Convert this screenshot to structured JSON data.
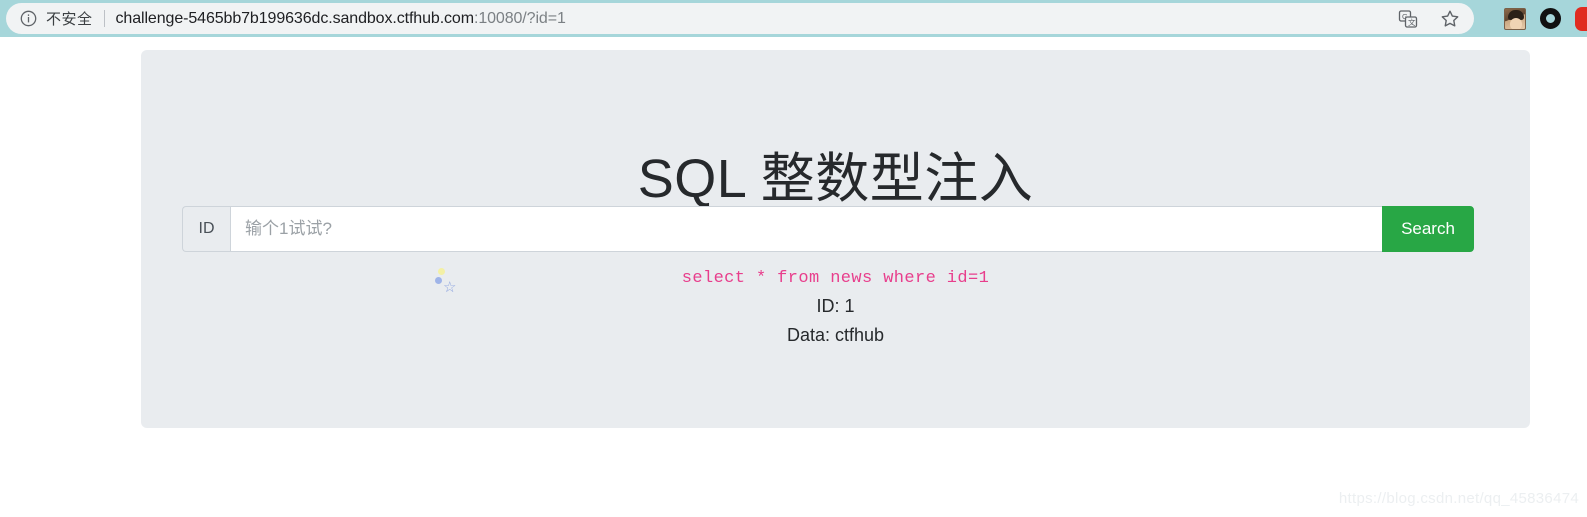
{
  "browser": {
    "security_label": "不安全",
    "security_icon": "info-circle-icon",
    "url_host": "challenge-5465bb7b199636dc.sandbox.ctfhub.com",
    "url_rest": ":10080/?id=1",
    "actions": {
      "translate": "translate-icon",
      "bookmark": "star-icon",
      "profile": "avatar",
      "extension_ring": "ring-icon",
      "extension_red": "red-extension-icon"
    }
  },
  "page": {
    "title": "SQL 整数型注入",
    "form": {
      "id_label": "ID",
      "id_value": "",
      "id_placeholder": "输个1试试?",
      "search_label": "Search"
    },
    "result": {
      "sql": "select * from news where id=1",
      "id_line": "ID: 1",
      "data_line": "Data: ctfhub"
    },
    "decor": {
      "sparkle_glyph": "☆"
    }
  },
  "watermark": "https://blog.csdn.net/qq_45836474",
  "colors": {
    "toolbar": "#a6d6da",
    "panel": "#e9ecef",
    "button_green": "#28a745",
    "sql_pink": "#e83e8c"
  }
}
